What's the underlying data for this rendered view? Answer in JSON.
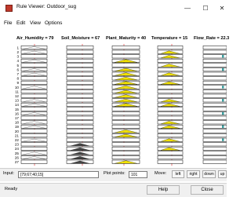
{
  "window": {
    "title": "Rule Viewer: Outdoor_sug",
    "min_glyph": "—",
    "max_glyph": "☐",
    "close_glyph": "✕"
  },
  "menu": [
    "File",
    "Edit",
    "View",
    "Options"
  ],
  "columns": [
    {
      "label": "Air_Humidity = 79"
    },
    {
      "label": "Soil_Moisture = 67"
    },
    {
      "label": "Plant_Maturity = 40"
    },
    {
      "label": "Temperature = 15"
    },
    {
      "label": "Flow_Rate = 22.3"
    }
  ],
  "rule_numbers": [
    "1",
    "2",
    "3",
    "4",
    "5",
    "6",
    "7",
    "8",
    "9",
    "10",
    "11",
    "12",
    "13",
    "14",
    "15",
    "16",
    "17",
    "18",
    "19",
    "20",
    "21",
    "22",
    "23",
    "24",
    "25",
    "26",
    "27"
  ],
  "controls": {
    "input_label": "Input:",
    "input_value": "[79;67;40;15]",
    "plot_points_label": "Plot points:",
    "plot_points_value": "101",
    "move_label": "Move:",
    "left": "left",
    "right": "right",
    "down": "down",
    "up": "up"
  },
  "status": {
    "text": "Ready",
    "help": "Help",
    "close": "Close"
  },
  "colors": {
    "fill_yellow": "#f2e200",
    "fill_teal": "#3aa0a0",
    "line_red": "#e02020",
    "frame": "#000000"
  }
}
